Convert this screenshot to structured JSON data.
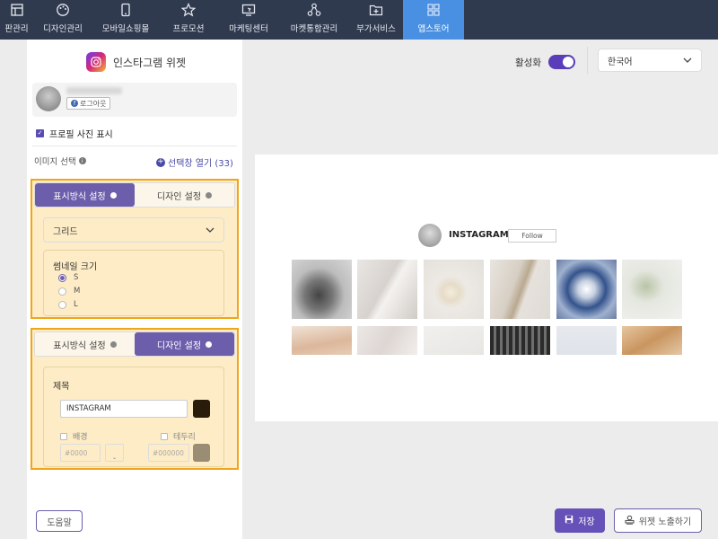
{
  "nav": {
    "items": [
      {
        "label": "판관리",
        "icon": "layout-icon"
      },
      {
        "label": "디자인관리",
        "icon": "palette-icon"
      },
      {
        "label": "모바일쇼핑몰",
        "icon": "mobile-icon"
      },
      {
        "label": "프로모션",
        "icon": "star-icon"
      },
      {
        "label": "마케팅센터",
        "icon": "monitor-icon"
      },
      {
        "label": "마켓통합관리",
        "icon": "network-icon"
      },
      {
        "label": "부가서비스",
        "icon": "folder-plus-icon"
      },
      {
        "label": "앱스토어",
        "icon": "apps-grid-icon"
      }
    ],
    "active_index": 7,
    "active_color": "#4a90e2",
    "bg_color": "#2f3a4f"
  },
  "panel": {
    "title": "인스타그램 위젯",
    "logout_label": "로그아웃",
    "show_profile_label": "프로필 사진 표시",
    "show_profile_checked": true,
    "image_select_label": "이미지 선택",
    "open_selector_label": "선택창 열기 (33)"
  },
  "display_settings": {
    "tab_display": "표시방식 설정",
    "tab_design": "디자인 설정",
    "layout_value": "그리드",
    "thumb_title": "썸네일 크기",
    "sizes": [
      "S",
      "M",
      "L"
    ],
    "selected_size": "S"
  },
  "design_settings": {
    "tab_display": "표시방식 설정",
    "tab_design": "디자인 설정",
    "title_label": "제목",
    "title_value": "INSTAGRAM",
    "title_color": "#2a1c0a",
    "bg_label": "배경",
    "bg_placeholder": "#0000",
    "border_label": "테두리",
    "border_placeholder": "#000000",
    "border_color": "#9a8d74"
  },
  "help_label": "도움말",
  "header": {
    "activate_label": "활성화",
    "activate_on": true,
    "language": "한국어"
  },
  "preview": {
    "account_name": "INSTAGRAM",
    "follow_label": "Follow"
  },
  "footer": {
    "save_label": "저장",
    "expose_label": "위젯 노출하기"
  },
  "colors": {
    "accent": "#6d5eac",
    "highlight_border": "#f0a51a",
    "highlight_bg": "#fdecc6"
  }
}
